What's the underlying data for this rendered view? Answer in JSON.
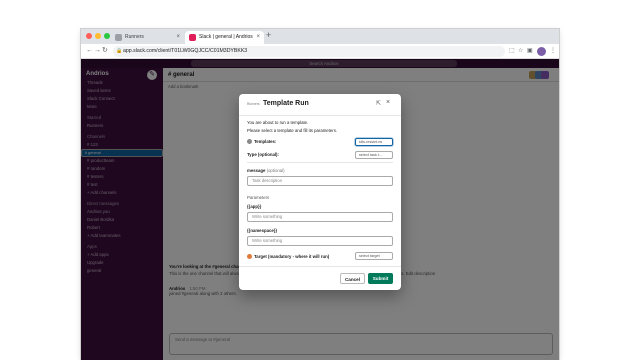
{
  "browser": {
    "tabs": [
      {
        "label": "Runners",
        "close": "×"
      },
      {
        "label": "Slack | general | Andrios",
        "close": "×"
      }
    ],
    "new_tab": "+",
    "url": "app.slack.com/client/T01LW0GQJCC/C01M3DYBKK3",
    "colors": {
      "close": "#ff5f57",
      "min": "#febc2e",
      "max": "#28c840"
    }
  },
  "slack": {
    "search_placeholder": "Search Andrios",
    "workspace": "Andrios",
    "sidebar_items": [
      {
        "label": "Threads"
      },
      {
        "label": "Saved items"
      },
      {
        "label": "Slack Connect"
      },
      {
        "label": "More"
      },
      {
        "label": "Starred",
        "header": true
      },
      {
        "label": "Runners"
      },
      {
        "label": "Channels",
        "header": true
      },
      {
        "label": "# 123"
      },
      {
        "label": "# general",
        "selected": true
      },
      {
        "label": "# productteam"
      },
      {
        "label": "# random"
      },
      {
        "label": "# testers"
      },
      {
        "label": "# test"
      },
      {
        "label": "+ Add channels"
      },
      {
        "label": "Direct messages",
        "header": true
      },
      {
        "label": "Andrios  you"
      },
      {
        "label": "Daniel Bordka"
      },
      {
        "label": "Robert"
      },
      {
        "label": "+ Add teammates"
      },
      {
        "label": "Apps",
        "header": true
      },
      {
        "label": "+ Add apps"
      },
      {
        "label": "Upgrade"
      },
      {
        "label": "general"
      }
    ],
    "channel_title": "# general",
    "details": "Add a bookmark",
    "messages": [
      {
        "author": "You're looking at the #general channel",
        "text": "This is the one channel that will always include everyone. It's a great spot for announcements and team-wide conversations. Edit description"
      },
      {
        "author": "Andrios",
        "time": "1:50 PM",
        "text": "joined #general along with 2 others."
      }
    ],
    "composer_placeholder": "Send a message to #general"
  },
  "modal": {
    "logo": "Runners",
    "title": "Template Run",
    "intro1": "You are about to run a template.",
    "intro2": "Please select a template and fill its parameters.",
    "templates_label": "Templates:",
    "templates_value": "k8s-restart-ns",
    "type_label": "Type (optional):",
    "type_placeholder": "select task t...",
    "message_label": "message",
    "message_optional": "(optional)",
    "message_placeholder": "Task description",
    "parameters_label": "Parameters",
    "app_label": "{{app}}",
    "app_placeholder": "Write something",
    "namespace_label": "{{namespace}}",
    "namespace_placeholder": "Write something",
    "target_label": "Target (mandatory - where it will run)",
    "target_placeholder": "select target",
    "cancel": "Cancel",
    "submit": "Submit"
  }
}
